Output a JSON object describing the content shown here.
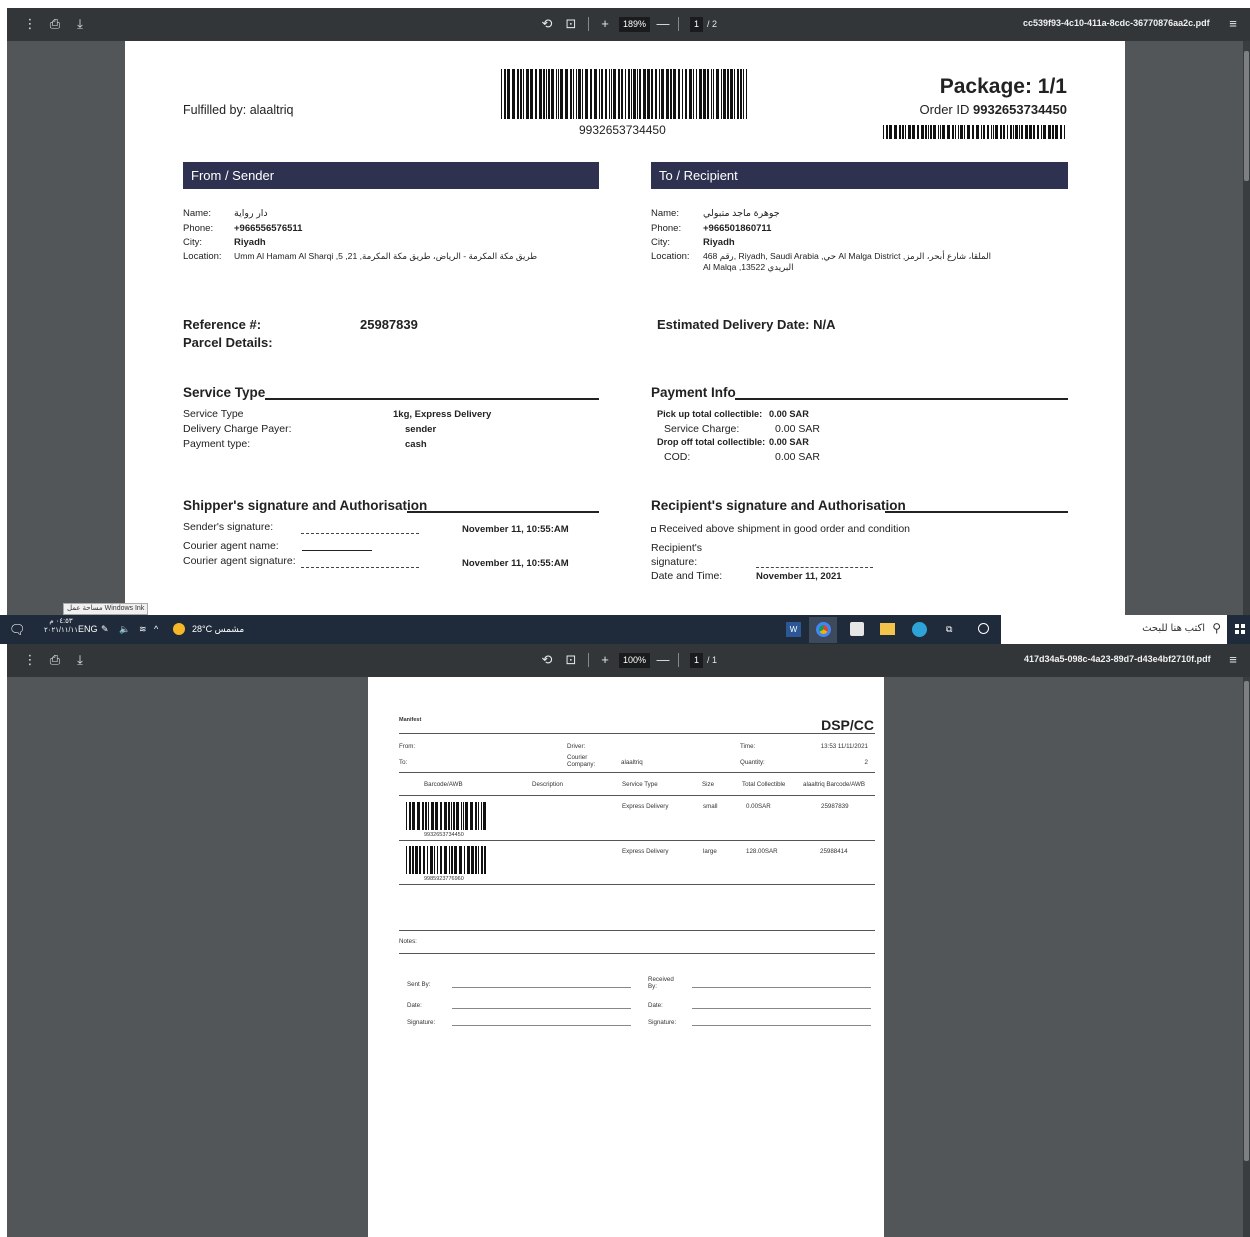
{
  "viewer_top": {
    "zoom": "189%",
    "page_current": "1",
    "page_total": "/ 2",
    "filename": "cc539f93-4c10-411a-8cdc-36770876aa2c.pdf",
    "plus": "+",
    "minus": "—"
  },
  "viewer_bottom": {
    "zoom": "100%",
    "page_current": "1",
    "page_total": "/ 1",
    "filename": "417d34a5-098c-4a23-89d7-d43e4bf2710f.pdf",
    "plus": "+",
    "minus": "—"
  },
  "label": {
    "fulfilled_by": "Fulfilled by: alaaltriq",
    "barcode_number": "9932653734450",
    "package": "Package: 1/1",
    "order_id_label": "Order ID ",
    "order_id": "9932653734450",
    "from_header": "From / Sender",
    "to_header": "To / Recipient",
    "sender": {
      "name_label": "Name:",
      "name": "دار رواية",
      "phone_label": "Phone:",
      "phone": "+966556576511",
      "city_label": "City:",
      "city": "Riyadh",
      "location_label": "Location:",
      "location": "Umm Al Hamam Al Sharqi ,5 ,21 ,طريق مكة المكرمة - الرياض، طريق مكة المكرمة"
    },
    "recipient": {
      "name_label": "Name:",
      "name": "جوهرة ماجد متبولي",
      "phone_label": "Phone:",
      "phone": "+966501860711",
      "city_label": "City:",
      "city": "Riyadh",
      "location_label": "Location:",
      "location_line1": "رقم 468, Riyadh, Saudi Arabia ,حي Al Malga District ,الملقا، شارع أبحر، الرمز",
      "location_line2": "Al Malqa ,13522 البريدي"
    },
    "reference_label": "Reference #:",
    "reference_value": "25987839",
    "parcel_details": "Parcel Details:",
    "estimated_delivery": "Estimated Delivery Date: N/A",
    "service_type_header": "Service Type",
    "service_rows": [
      {
        "label": "Service Type",
        "value": "1kg, Express Delivery"
      },
      {
        "label": "Delivery Charge Payer:",
        "value": "sender"
      },
      {
        "label": "Payment type:",
        "value": "cash"
      }
    ],
    "payment_header": "Payment Info",
    "payment": {
      "pickup_label": "Pick up total collectible:",
      "pickup_value": "0.00 SAR",
      "service_charge_label": "Service Charge:",
      "service_charge_value": "0.00 SAR",
      "dropoff_label": "Drop off total collectible:",
      "dropoff_value": "0.00 SAR",
      "cod_label": "COD:",
      "cod_value": "0.00 SAR"
    },
    "shipper_header": "Shipper's signature and Authorisation",
    "shipper": {
      "sender_sig": "Sender's signature:",
      "courier_name": "Courier agent name:",
      "courier_sig": "Courier agent signature:",
      "date1": "November 11, 10:55:AM",
      "date2": "November 11, 10:55:AM"
    },
    "recipient_header": "Recipient's signature and Authorisation",
    "recipient_sig": {
      "received": "Received above shipment in good order and condition",
      "sig_line1": "Recipient's",
      "sig_line2": "signature:",
      "date_label": "Date and Time:",
      "date_value": "November 11, 2021"
    }
  },
  "taskbar": {
    "search_placeholder": "اكتب هنا للبحث",
    "weather": "28°C مشمس",
    "lang": "ENG",
    "time": "٠٤:٥٣ م",
    "date": "٢٠٢١/١١/١١",
    "ink_tooltip": "مساحة عمل Windows Ink"
  },
  "manifest": {
    "title": "Manifest",
    "brand": "DSP/CC",
    "from_label": "From:",
    "to_label": "To:",
    "driver_label": "Driver:",
    "courier_label": "Courier Company:",
    "courier_value": "alaaltriq",
    "time_label": "Time:",
    "time_value": "13:53 11/11/2021",
    "quantity_label": "Quantity:",
    "quantity_value": "2",
    "columns": [
      "Barcode/AWB",
      "Description",
      "Service Type",
      "Size",
      "Total Collectible",
      "alaaltriq Barcode/AWB"
    ],
    "rows": [
      {
        "barcode": "9932653734450",
        "description": "",
        "service": "Express Delivery",
        "size": "small",
        "total": "0.00SAR",
        "ref": "25987839"
      },
      {
        "barcode": "9985923776960",
        "description": "",
        "service": "Express Delivery",
        "size": "large",
        "total": "128.00SAR",
        "ref": "25988414"
      }
    ],
    "notes_label": "Notes:",
    "sent_by": "Sent By:",
    "received_by": "Received By:",
    "date_label": "Date:",
    "signature_label": "Signature:"
  }
}
